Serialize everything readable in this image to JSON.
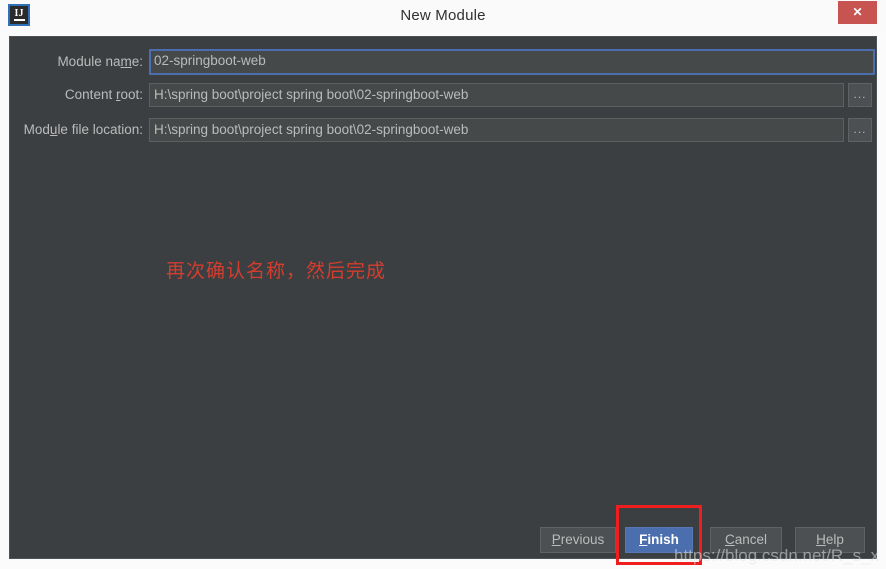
{
  "window": {
    "title": "New Module",
    "app_icon": "intellij-idea-icon",
    "app_icon_letters": "IJ",
    "close_label": "✕",
    "background_color": "#3c3f41",
    "titlebar_color": "#fafafa",
    "close_button_color": "#c75450"
  },
  "form": {
    "rows": [
      {
        "label_before": "Module na",
        "label_mnemonic": "m",
        "label_after": "e:",
        "value": "02-springboot-web",
        "placeholder": "",
        "focused": true,
        "has_browse": false
      },
      {
        "label_before": "Content ",
        "label_mnemonic": "r",
        "label_after": "oot:",
        "value": "H:\\spring boot\\project spring boot\\02-springboot-web",
        "placeholder": "",
        "focused": false,
        "has_browse": true,
        "browse_label": "..."
      },
      {
        "label_before": "Mod",
        "label_mnemonic": "u",
        "label_after": "le file location:",
        "value": "H:\\spring boot\\project spring boot\\02-springboot-web",
        "placeholder": "",
        "focused": false,
        "has_browse": true,
        "browse_label": "..."
      }
    ]
  },
  "annotation": {
    "text": "再次确认名称，然后完成",
    "color": "#d43d2e",
    "highlight_color": "#f01f1f",
    "highlight_target": "Finish"
  },
  "buttons": {
    "previous": {
      "before": "",
      "mnemonic": "P",
      "after": "revious"
    },
    "finish": {
      "before": "",
      "mnemonic": "F",
      "after": "inish",
      "primary": true,
      "accent_color": "#4b6eaf"
    },
    "cancel": {
      "before": "",
      "mnemonic": "C",
      "after": "ancel"
    },
    "help": {
      "before": "",
      "mnemonic": "H",
      "after": "elp"
    }
  },
  "watermark": {
    "text": "https://blog.csdn.net/R_s_x"
  }
}
